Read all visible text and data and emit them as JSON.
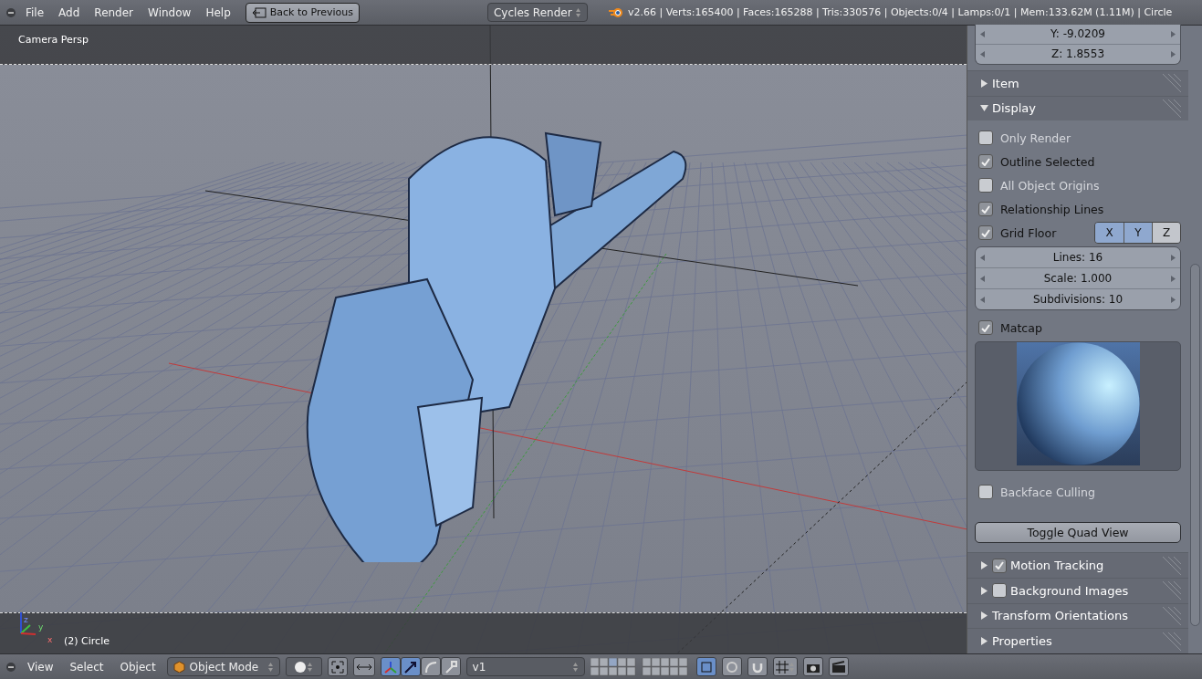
{
  "menu_bar": {
    "items": [
      "File",
      "Add",
      "Render",
      "Window",
      "Help"
    ],
    "back_button": "Back to Previous",
    "render_engine": "Cycles Render",
    "stats": "v2.66 | Verts:165400 | Faces:165288 | Tris:330576 | Objects:0/4 | Lamps:0/1 | Mem:133.62M (1.11M) | Circle"
  },
  "viewport": {
    "view_name": "Camera Persp",
    "object_label": "(2) Circle",
    "axes": [
      "z",
      "y",
      "x"
    ]
  },
  "properties_panel": {
    "fields": [
      "Y: -9.0209",
      "Z: 1.8553"
    ],
    "sections": [
      {
        "title": "Item",
        "expanded": false
      },
      {
        "title": "Display",
        "expanded": true,
        "rows": [
          {
            "kind": "checkbox",
            "label": "Only Render",
            "checked": false
          },
          {
            "kind": "checkbox",
            "label": "Outline Selected",
            "checked": true
          },
          {
            "kind": "checkbox",
            "label": "All Object Origins",
            "checked": false
          },
          {
            "kind": "checkbox",
            "label": "Relationship Lines",
            "checked": true
          },
          {
            "kind": "grid_floor",
            "label": "Grid Floor",
            "checked": true,
            "axes": [
              {
                "label": "X",
                "selected": true
              },
              {
                "label": "Y",
                "selected": true
              },
              {
                "label": "Z",
                "selected": false
              }
            ]
          },
          {
            "kind": "numbers",
            "fields": [
              "Lines: 16",
              "Scale: 1.000",
              "Subdivisions: 10"
            ]
          },
          {
            "kind": "checkbox",
            "label": "Matcap",
            "checked": true
          },
          {
            "kind": "matcap"
          },
          {
            "kind": "checkbox",
            "label": "Backface Culling",
            "checked": false
          },
          {
            "kind": "button",
            "label": "Toggle Quad View"
          }
        ]
      },
      {
        "title": "Motion Tracking",
        "expanded": false,
        "checked": true
      },
      {
        "title": "Background Images",
        "expanded": false,
        "checked": false
      },
      {
        "title": "Transform Orientations",
        "expanded": false
      },
      {
        "title": "Properties",
        "expanded": false
      }
    ]
  },
  "bottom_toolbar": {
    "menus": [
      "View",
      "Select",
      "Object"
    ],
    "mode": "Object Mode",
    "orientation": "v1",
    "manipulators": [
      {
        "selected": true
      },
      {
        "selected": true
      },
      {
        "selected": false
      },
      {
        "selected": false
      }
    ]
  }
}
